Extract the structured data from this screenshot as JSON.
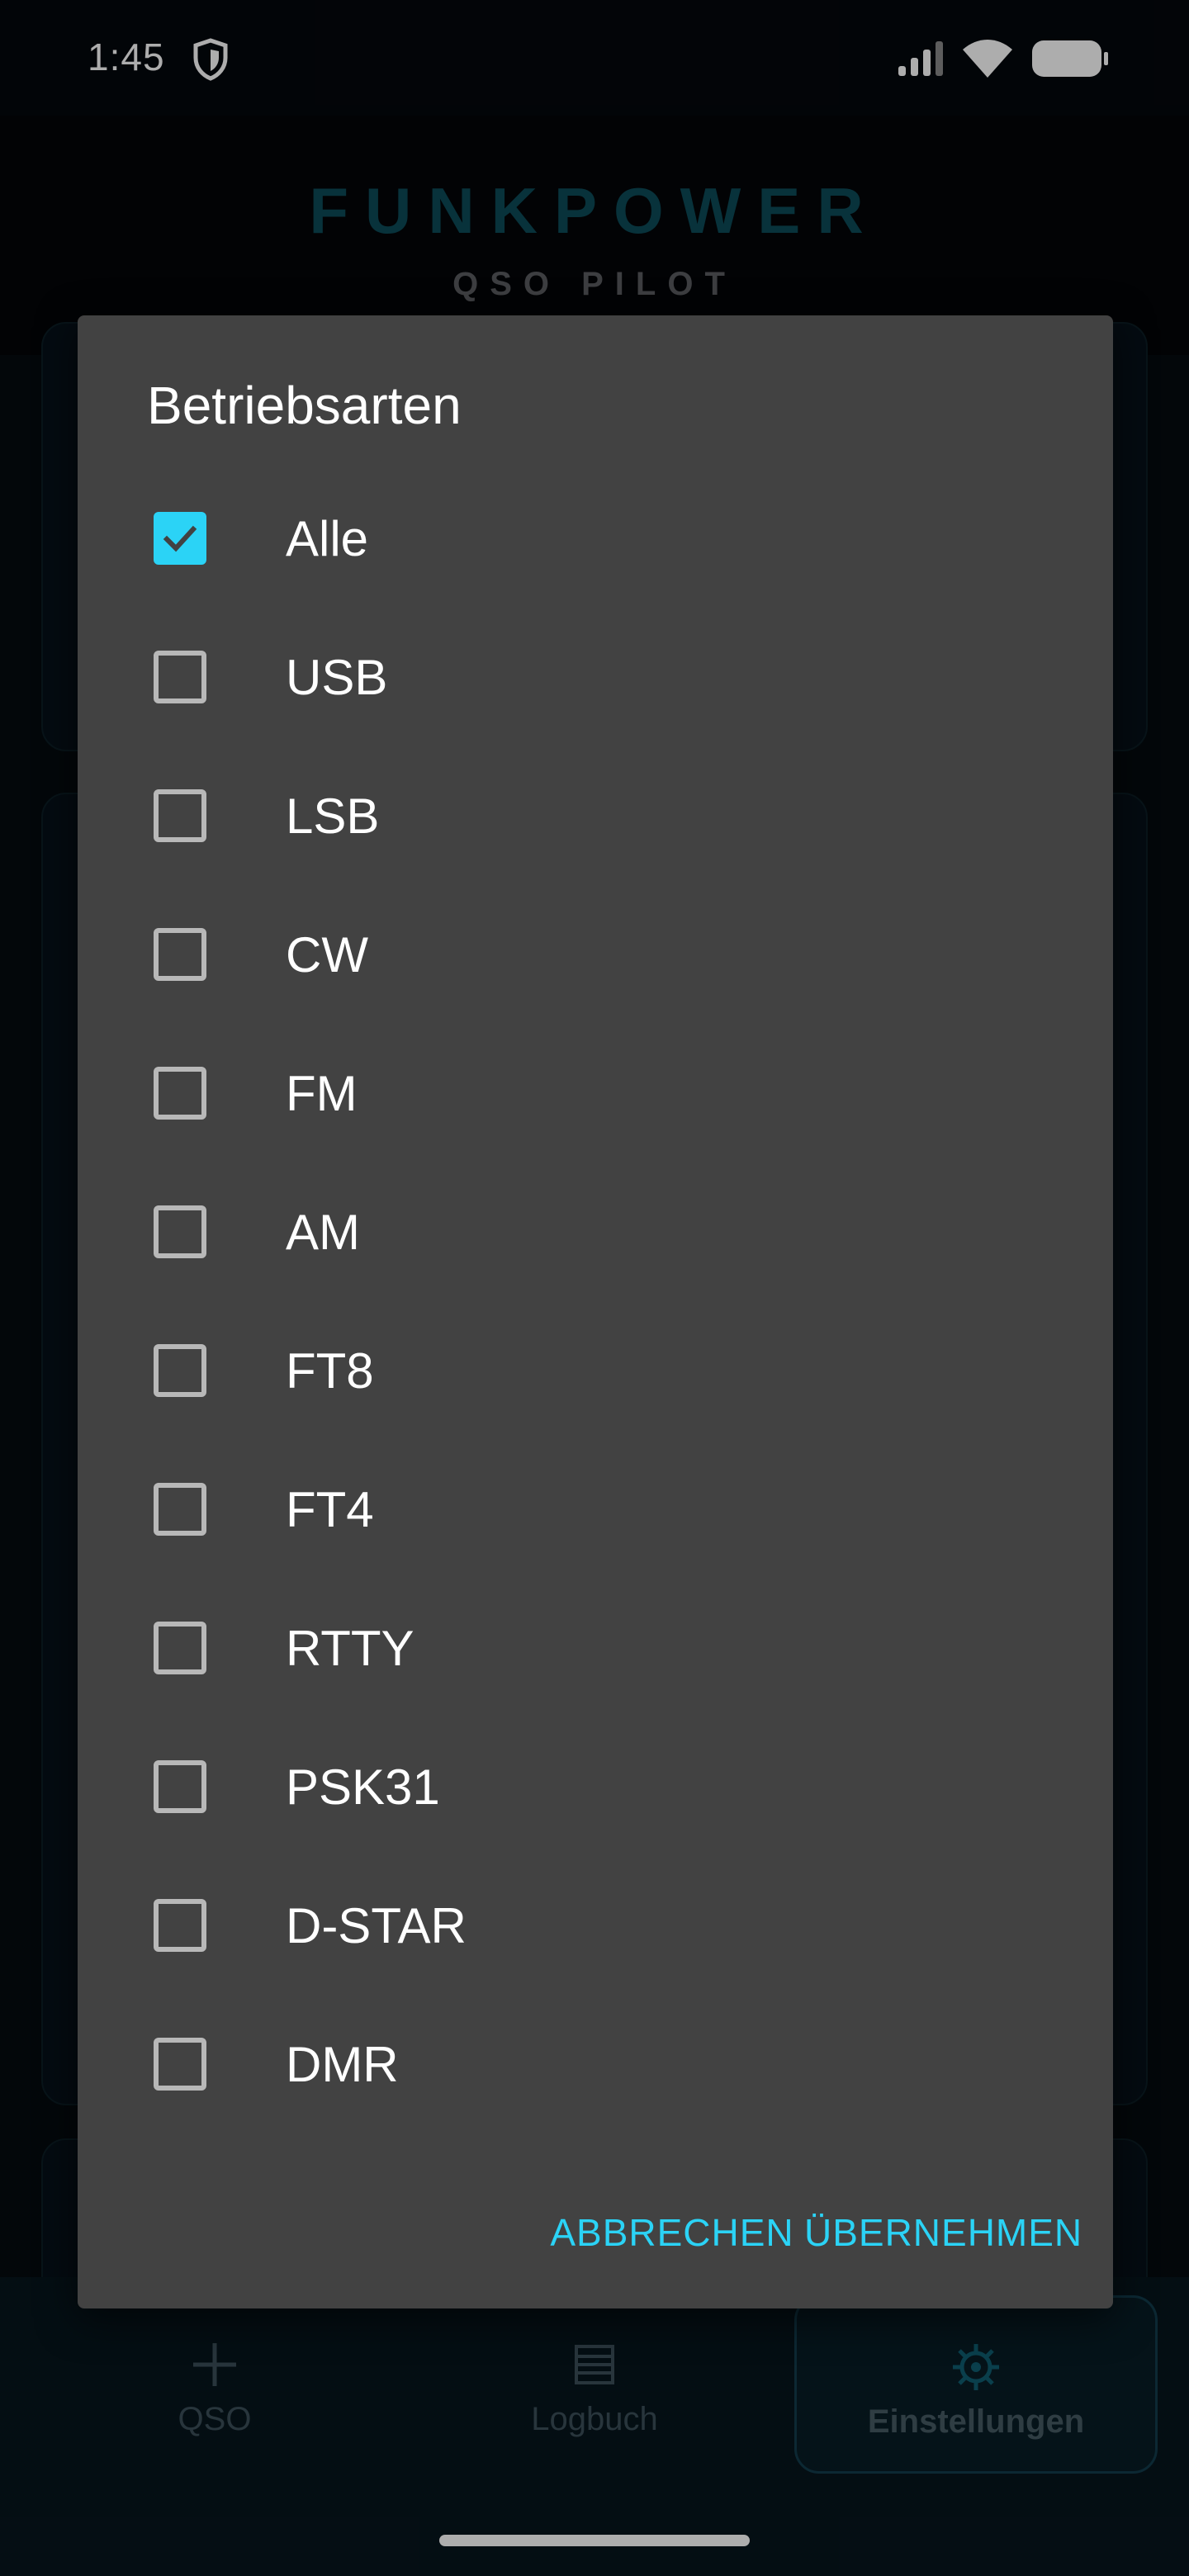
{
  "status_bar": {
    "time": "1:45",
    "icons": [
      "shield-icon",
      "signal-icon",
      "wifi-icon",
      "battery-icon"
    ]
  },
  "header": {
    "title": "FUNKPOWER",
    "subtitle": "QSO PILOT"
  },
  "bottom_nav": {
    "items": [
      {
        "label": "QSO",
        "icon": "plus-icon",
        "active": false
      },
      {
        "label": "Logbuch",
        "icon": "list-icon",
        "active": false
      },
      {
        "label": "Einstellungen",
        "icon": "gear-icon",
        "active": true
      }
    ]
  },
  "dialog": {
    "title": "Betriebsarten",
    "options": [
      {
        "label": "Alle",
        "checked": true
      },
      {
        "label": "USB",
        "checked": false
      },
      {
        "label": "LSB",
        "checked": false
      },
      {
        "label": "CW",
        "checked": false
      },
      {
        "label": "FM",
        "checked": false
      },
      {
        "label": "AM",
        "checked": false
      },
      {
        "label": "FT8",
        "checked": false
      },
      {
        "label": "FT4",
        "checked": false
      },
      {
        "label": "RTTY",
        "checked": false
      },
      {
        "label": "PSK31",
        "checked": false
      },
      {
        "label": "D-STAR",
        "checked": false
      },
      {
        "label": "DMR",
        "checked": false
      }
    ],
    "cancel_label": "ABBRECHEN",
    "apply_label": "ÜBERNEHMEN"
  },
  "colors": {
    "accent": "#2bd3f6",
    "dialog_bg": "#424242",
    "brand": "#0c4a58"
  }
}
